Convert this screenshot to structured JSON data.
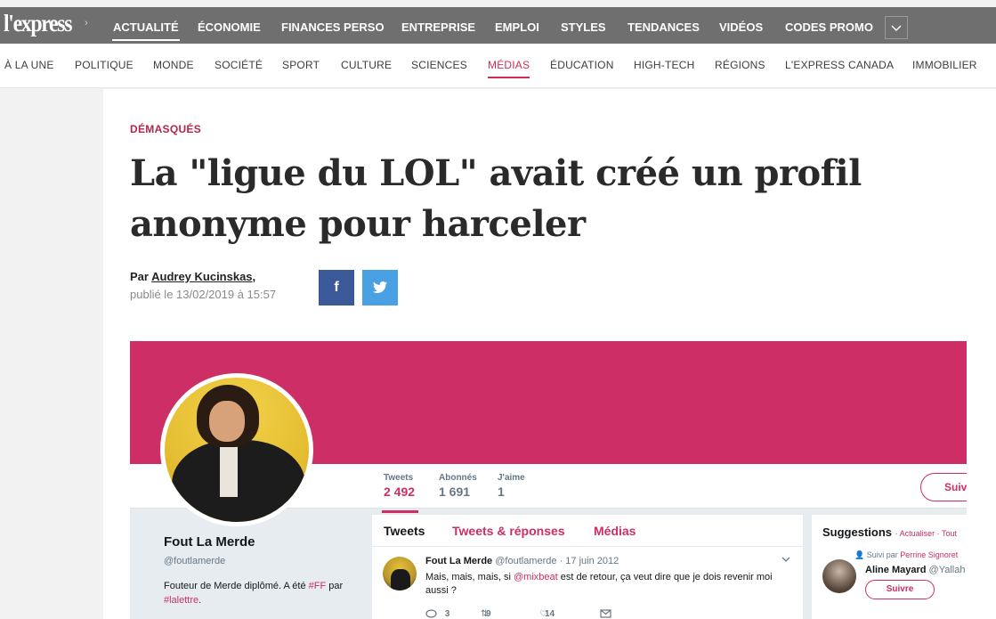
{
  "brand": {
    "logo": "l'express"
  },
  "top_nav": {
    "items": [
      "ACTUALITÉ",
      "ÉCONOMIE",
      "FINANCES PERSO",
      "ENTREPRISE",
      "EMPLOI",
      "STYLES",
      "TENDANCES",
      "VIDÉOS",
      "CODES PROMO"
    ],
    "active": "ACTUALITÉ",
    "more_icon": "chevron-down-icon"
  },
  "sub_nav": {
    "items": [
      "À LA UNE",
      "POLITIQUE",
      "MONDE",
      "SOCIÉTÉ",
      "SPORT",
      "CULTURE",
      "SCIENCES",
      "MÉDIAS",
      "ÉDUCATION",
      "HIGH-TECH",
      "RÉGIONS",
      "L'EXPRESS CANADA",
      "IMMOBILIER"
    ],
    "active": "MÉDIAS"
  },
  "article": {
    "kicker": "DÉMASQUÉS",
    "headline_line1": "La \"ligue du LOL\" avait créé un profil",
    "headline_line2": "anonyme pour harceler",
    "byline_prefix": "Par",
    "author": "Audrey Kucinskas,",
    "published": "publié le 13/02/2019 à 15:57",
    "share": {
      "facebook": "f",
      "twitter_icon": "twitter-bird-icon"
    }
  },
  "embed": {
    "colors": {
      "accent": "#cc2e65",
      "banner": "#cc2e65"
    },
    "stats": [
      {
        "label": "Tweets",
        "value": "2 492"
      },
      {
        "label": "Abonnés",
        "value": "1 691"
      },
      {
        "label": "J'aime",
        "value": "1"
      }
    ],
    "follow_label": "Suivre",
    "profile": {
      "name": "Fout La Merde",
      "handle": "@foutlamerde",
      "bio_pre": "Fouteur de Merde diplômé. A été ",
      "bio_tag1": "#FF",
      "bio_mid": " par",
      "bio_tag2": "#lalettre",
      "bio_post": "."
    },
    "tabs": [
      "Tweets",
      "Tweets & réponses",
      "Médias"
    ],
    "tweet": {
      "name": "Fout La Merde",
      "handle": "@foutlamerde",
      "date": "· 17 juin 2012",
      "text_pre": "Mais, mais, mais, si ",
      "mention": "@mixbeat",
      "text_post": " est de retour, ça veut dire que je dois revenir moi aussi ?",
      "replies": "3",
      "retweets": "9",
      "likes": "14"
    },
    "suggestions": {
      "title": "Suggestions",
      "links": "· Actualiser · Tout",
      "followed_by_prefix": "Suivi par",
      "followed_by": "Perrine Signoret",
      "name": "Aline Mayard",
      "handle": "@Yallah",
      "button": "Suivre"
    }
  }
}
